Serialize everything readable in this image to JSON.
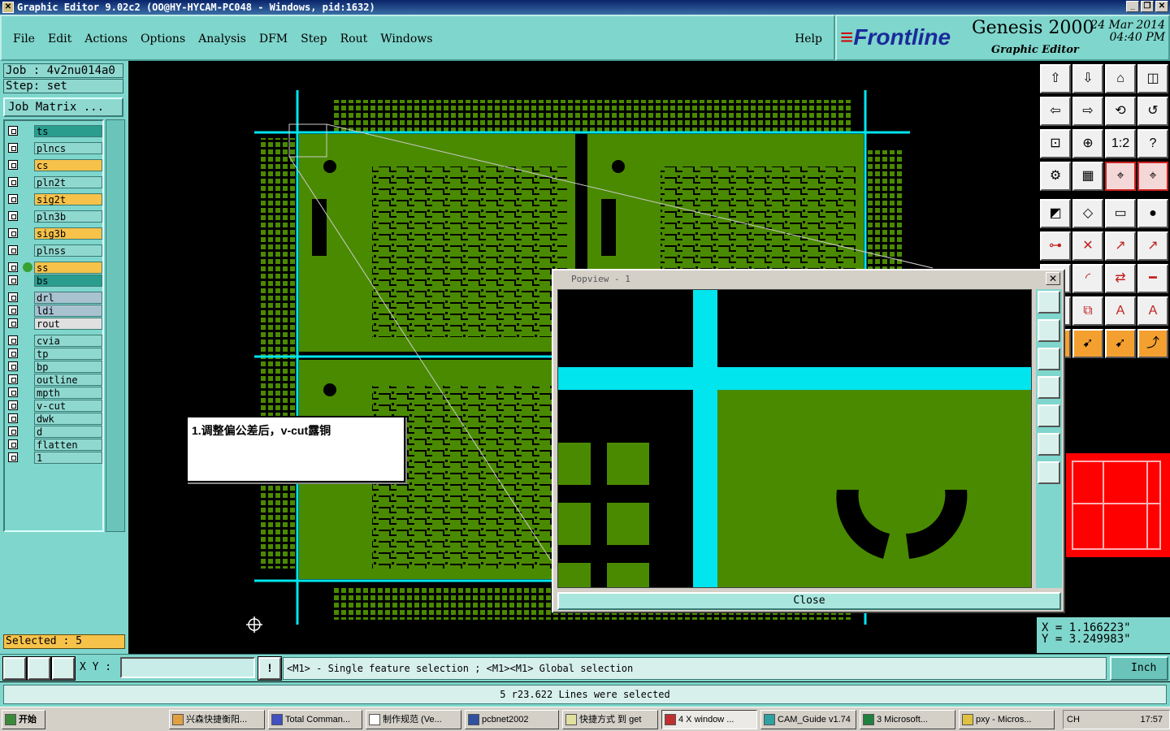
{
  "window": {
    "title": "Graphic Editor 9.02c2  (OO@HY-HYCAM-PC048 - Windows, pid:1632)"
  },
  "menu": {
    "items": [
      "File",
      "Edit",
      "Actions",
      "Options",
      "Analysis",
      "DFM",
      "Step",
      "Rout",
      "Windows"
    ],
    "help": "Help"
  },
  "brand": {
    "logo": "Frontline",
    "product": "Genesis 2000",
    "subtitle": "Graphic Editor",
    "date": "24 Mar 2014",
    "time": "04:40 PM"
  },
  "job": {
    "job_label": "Job :  4v2nu014a0",
    "step_label": "Step:  set",
    "matrix_button": "Job Matrix ..."
  },
  "layers": [
    {
      "name": "ts",
      "color": "#2a9d8f"
    },
    {
      "name": "plncs",
      "color": "#8fd8d0"
    },
    {
      "name": "cs",
      "color": "#f7c24a"
    },
    {
      "name": "pln2t",
      "color": "#8fd8d0"
    },
    {
      "name": "sig2t",
      "color": "#f7c24a"
    },
    {
      "name": "pln3b",
      "color": "#8fd8d0"
    },
    {
      "name": "sig3b",
      "color": "#f7c24a"
    },
    {
      "name": "plnss",
      "color": "#8fd8d0"
    },
    {
      "name": "ss",
      "color": "#f7c24a"
    },
    {
      "name": "bs",
      "color": "#2a9d8f"
    },
    {
      "name": "drl",
      "color": "#a9c2d0"
    },
    {
      "name": "ldi",
      "color": "#a9c2d0"
    },
    {
      "name": "rout",
      "color": "#e0e0e0"
    },
    {
      "name": "cvia",
      "color": "#8fd8d0"
    },
    {
      "name": "tp",
      "color": "#8fd8d0"
    },
    {
      "name": "bp",
      "color": "#8fd8d0"
    },
    {
      "name": "outline",
      "color": "#8fd8d0"
    },
    {
      "name": "mpth",
      "color": "#8fd8d0"
    },
    {
      "name": "v-cut",
      "color": "#8fd8d0"
    },
    {
      "name": "dwk",
      "color": "#8fd8d0"
    },
    {
      "name": "d",
      "color": "#8fd8d0"
    },
    {
      "name": "flatten",
      "color": "#8fd8d0"
    },
    {
      "name": "1",
      "color": "#8fd8d0"
    }
  ],
  "selected_text": "Selected : 5",
  "annotation": "1.调整偏公差后，v-cut露铜",
  "popview": {
    "title": "Popview - 1",
    "close_label": "Close"
  },
  "coords": {
    "x": "X  =  1.166223\"",
    "y": "Y  =  3.249983\""
  },
  "bottom": {
    "xy_label": "X Y :",
    "xy_value": "",
    "hint": "<M1> - Single feature selection ; <M1><M1> Global selection",
    "units": "Inch",
    "status": "5 r23.622 Lines were selected"
  },
  "taskbar": {
    "start": "开始",
    "tasks": [
      "兴森快捷衡阳...",
      "Total Comman...",
      "制作规范 (Ve...",
      "pcbnet2002",
      "快捷方式 到 get",
      "4 X window ...",
      "CAM_Guide v1.74",
      "3 Microsoft...",
      "pxy - Micros..."
    ],
    "clock": "17:57",
    "tray_lang": "CH"
  },
  "colors": {
    "panel": "#7fd6cc",
    "copper": "#4a8a00",
    "vcut": "#00e5ee",
    "highlight": "#f7c24a"
  }
}
